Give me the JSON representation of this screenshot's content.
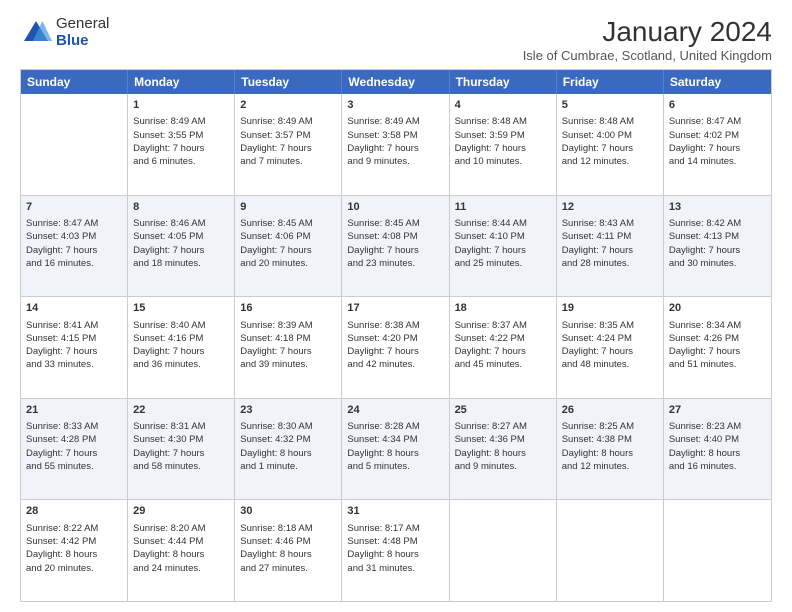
{
  "logo": {
    "general": "General",
    "blue": "Blue"
  },
  "title": "January 2024",
  "subtitle": "Isle of Cumbrae, Scotland, United Kingdom",
  "days": [
    "Sunday",
    "Monday",
    "Tuesday",
    "Wednesday",
    "Thursday",
    "Friday",
    "Saturday"
  ],
  "weeks": [
    {
      "alt": false,
      "cells": [
        {
          "day": "",
          "data": ""
        },
        {
          "day": "1",
          "data": "Sunrise: 8:49 AM\nSunset: 3:55 PM\nDaylight: 7 hours\nand 6 minutes."
        },
        {
          "day": "2",
          "data": "Sunrise: 8:49 AM\nSunset: 3:57 PM\nDaylight: 7 hours\nand 7 minutes."
        },
        {
          "day": "3",
          "data": "Sunrise: 8:49 AM\nSunset: 3:58 PM\nDaylight: 7 hours\nand 9 minutes."
        },
        {
          "day": "4",
          "data": "Sunrise: 8:48 AM\nSunset: 3:59 PM\nDaylight: 7 hours\nand 10 minutes."
        },
        {
          "day": "5",
          "data": "Sunrise: 8:48 AM\nSunset: 4:00 PM\nDaylight: 7 hours\nand 12 minutes."
        },
        {
          "day": "6",
          "data": "Sunrise: 8:47 AM\nSunset: 4:02 PM\nDaylight: 7 hours\nand 14 minutes."
        }
      ]
    },
    {
      "alt": true,
      "cells": [
        {
          "day": "7",
          "data": "Sunrise: 8:47 AM\nSunset: 4:03 PM\nDaylight: 7 hours\nand 16 minutes."
        },
        {
          "day": "8",
          "data": "Sunrise: 8:46 AM\nSunset: 4:05 PM\nDaylight: 7 hours\nand 18 minutes."
        },
        {
          "day": "9",
          "data": "Sunrise: 8:45 AM\nSunset: 4:06 PM\nDaylight: 7 hours\nand 20 minutes."
        },
        {
          "day": "10",
          "data": "Sunrise: 8:45 AM\nSunset: 4:08 PM\nDaylight: 7 hours\nand 23 minutes."
        },
        {
          "day": "11",
          "data": "Sunrise: 8:44 AM\nSunset: 4:10 PM\nDaylight: 7 hours\nand 25 minutes."
        },
        {
          "day": "12",
          "data": "Sunrise: 8:43 AM\nSunset: 4:11 PM\nDaylight: 7 hours\nand 28 minutes."
        },
        {
          "day": "13",
          "data": "Sunrise: 8:42 AM\nSunset: 4:13 PM\nDaylight: 7 hours\nand 30 minutes."
        }
      ]
    },
    {
      "alt": false,
      "cells": [
        {
          "day": "14",
          "data": "Sunrise: 8:41 AM\nSunset: 4:15 PM\nDaylight: 7 hours\nand 33 minutes."
        },
        {
          "day": "15",
          "data": "Sunrise: 8:40 AM\nSunset: 4:16 PM\nDaylight: 7 hours\nand 36 minutes."
        },
        {
          "day": "16",
          "data": "Sunrise: 8:39 AM\nSunset: 4:18 PM\nDaylight: 7 hours\nand 39 minutes."
        },
        {
          "day": "17",
          "data": "Sunrise: 8:38 AM\nSunset: 4:20 PM\nDaylight: 7 hours\nand 42 minutes."
        },
        {
          "day": "18",
          "data": "Sunrise: 8:37 AM\nSunset: 4:22 PM\nDaylight: 7 hours\nand 45 minutes."
        },
        {
          "day": "19",
          "data": "Sunrise: 8:35 AM\nSunset: 4:24 PM\nDaylight: 7 hours\nand 48 minutes."
        },
        {
          "day": "20",
          "data": "Sunrise: 8:34 AM\nSunset: 4:26 PM\nDaylight: 7 hours\nand 51 minutes."
        }
      ]
    },
    {
      "alt": true,
      "cells": [
        {
          "day": "21",
          "data": "Sunrise: 8:33 AM\nSunset: 4:28 PM\nDaylight: 7 hours\nand 55 minutes."
        },
        {
          "day": "22",
          "data": "Sunrise: 8:31 AM\nSunset: 4:30 PM\nDaylight: 7 hours\nand 58 minutes."
        },
        {
          "day": "23",
          "data": "Sunrise: 8:30 AM\nSunset: 4:32 PM\nDaylight: 8 hours\nand 1 minute."
        },
        {
          "day": "24",
          "data": "Sunrise: 8:28 AM\nSunset: 4:34 PM\nDaylight: 8 hours\nand 5 minutes."
        },
        {
          "day": "25",
          "data": "Sunrise: 8:27 AM\nSunset: 4:36 PM\nDaylight: 8 hours\nand 9 minutes."
        },
        {
          "day": "26",
          "data": "Sunrise: 8:25 AM\nSunset: 4:38 PM\nDaylight: 8 hours\nand 12 minutes."
        },
        {
          "day": "27",
          "data": "Sunrise: 8:23 AM\nSunset: 4:40 PM\nDaylight: 8 hours\nand 16 minutes."
        }
      ]
    },
    {
      "alt": false,
      "cells": [
        {
          "day": "28",
          "data": "Sunrise: 8:22 AM\nSunset: 4:42 PM\nDaylight: 8 hours\nand 20 minutes."
        },
        {
          "day": "29",
          "data": "Sunrise: 8:20 AM\nSunset: 4:44 PM\nDaylight: 8 hours\nand 24 minutes."
        },
        {
          "day": "30",
          "data": "Sunrise: 8:18 AM\nSunset: 4:46 PM\nDaylight: 8 hours\nand 27 minutes."
        },
        {
          "day": "31",
          "data": "Sunrise: 8:17 AM\nSunset: 4:48 PM\nDaylight: 8 hours\nand 31 minutes."
        },
        {
          "day": "",
          "data": ""
        },
        {
          "day": "",
          "data": ""
        },
        {
          "day": "",
          "data": ""
        }
      ]
    }
  ]
}
